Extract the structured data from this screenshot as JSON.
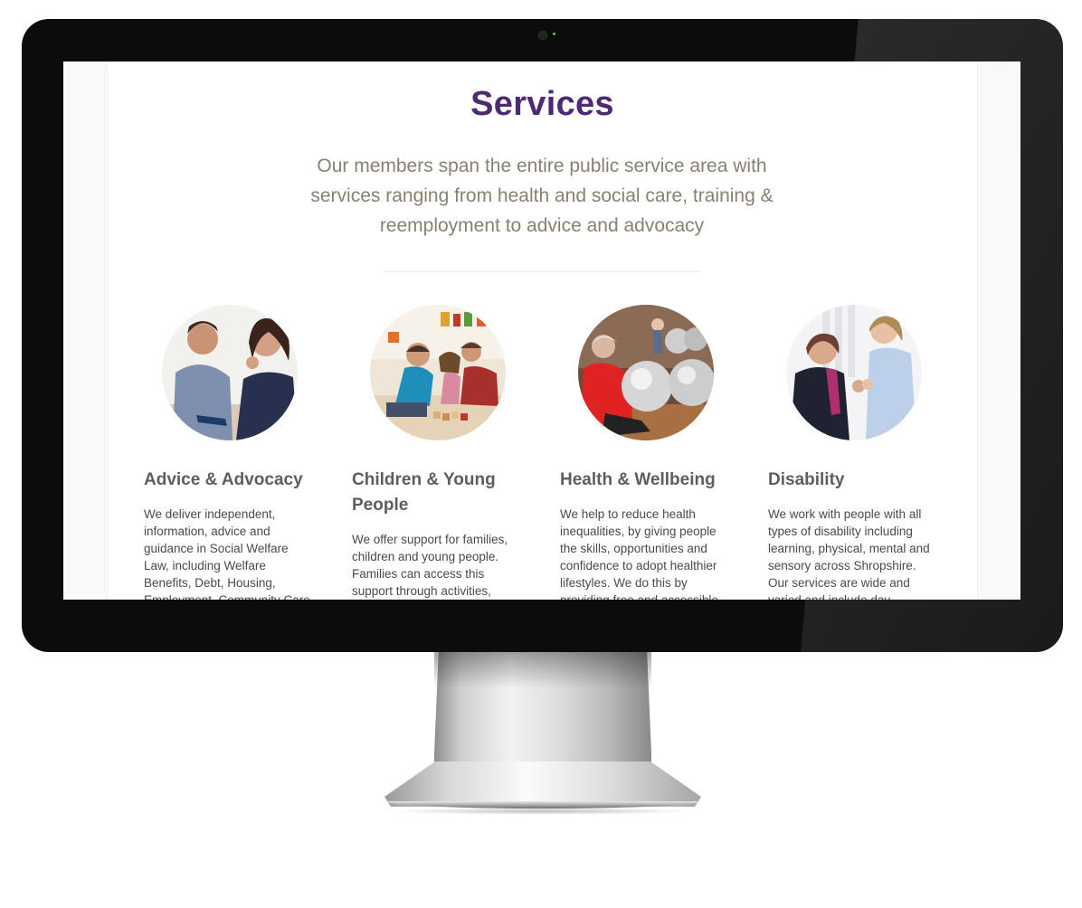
{
  "page": {
    "title": "Services",
    "intro": "Our members span the entire public service area with services ranging from health and social care, training & reemployment to advice and advocacy"
  },
  "services": [
    {
      "heading": "Advice & Advocacy",
      "text": "We deliver independent, information, advice and guidance in Social Welfare Law, including Welfare Benefits, Debt, Housing, Employment, Community Care",
      "image": "two-adults-at-desk-photo"
    },
    {
      "heading": "Children & Young People",
      "text": "We offer support for families, children and young people. Families can access this support through activities,",
      "image": "children-playing-blocks-photo"
    },
    {
      "heading": "Health & Wellbeing",
      "text": "We help to reduce health inequalities, by giving people the skills, opportunities and confidence to adopt healthier lifestyles. We do this by providing free and accessible",
      "image": "exercise-balls-class-photo"
    },
    {
      "heading": "Disability",
      "text": "We work with people with all types of disability including learning, physical, mental and sensory across Shropshire. Our services are wide and varied and include day",
      "image": "carer-with-elderly-woman-photo"
    }
  ],
  "colors": {
    "title": "#4d2a73",
    "intro": "#8a8071",
    "heading": "#5e5e5e",
    "body": "#4a4a4a",
    "bezel": "#0c0c0c"
  }
}
